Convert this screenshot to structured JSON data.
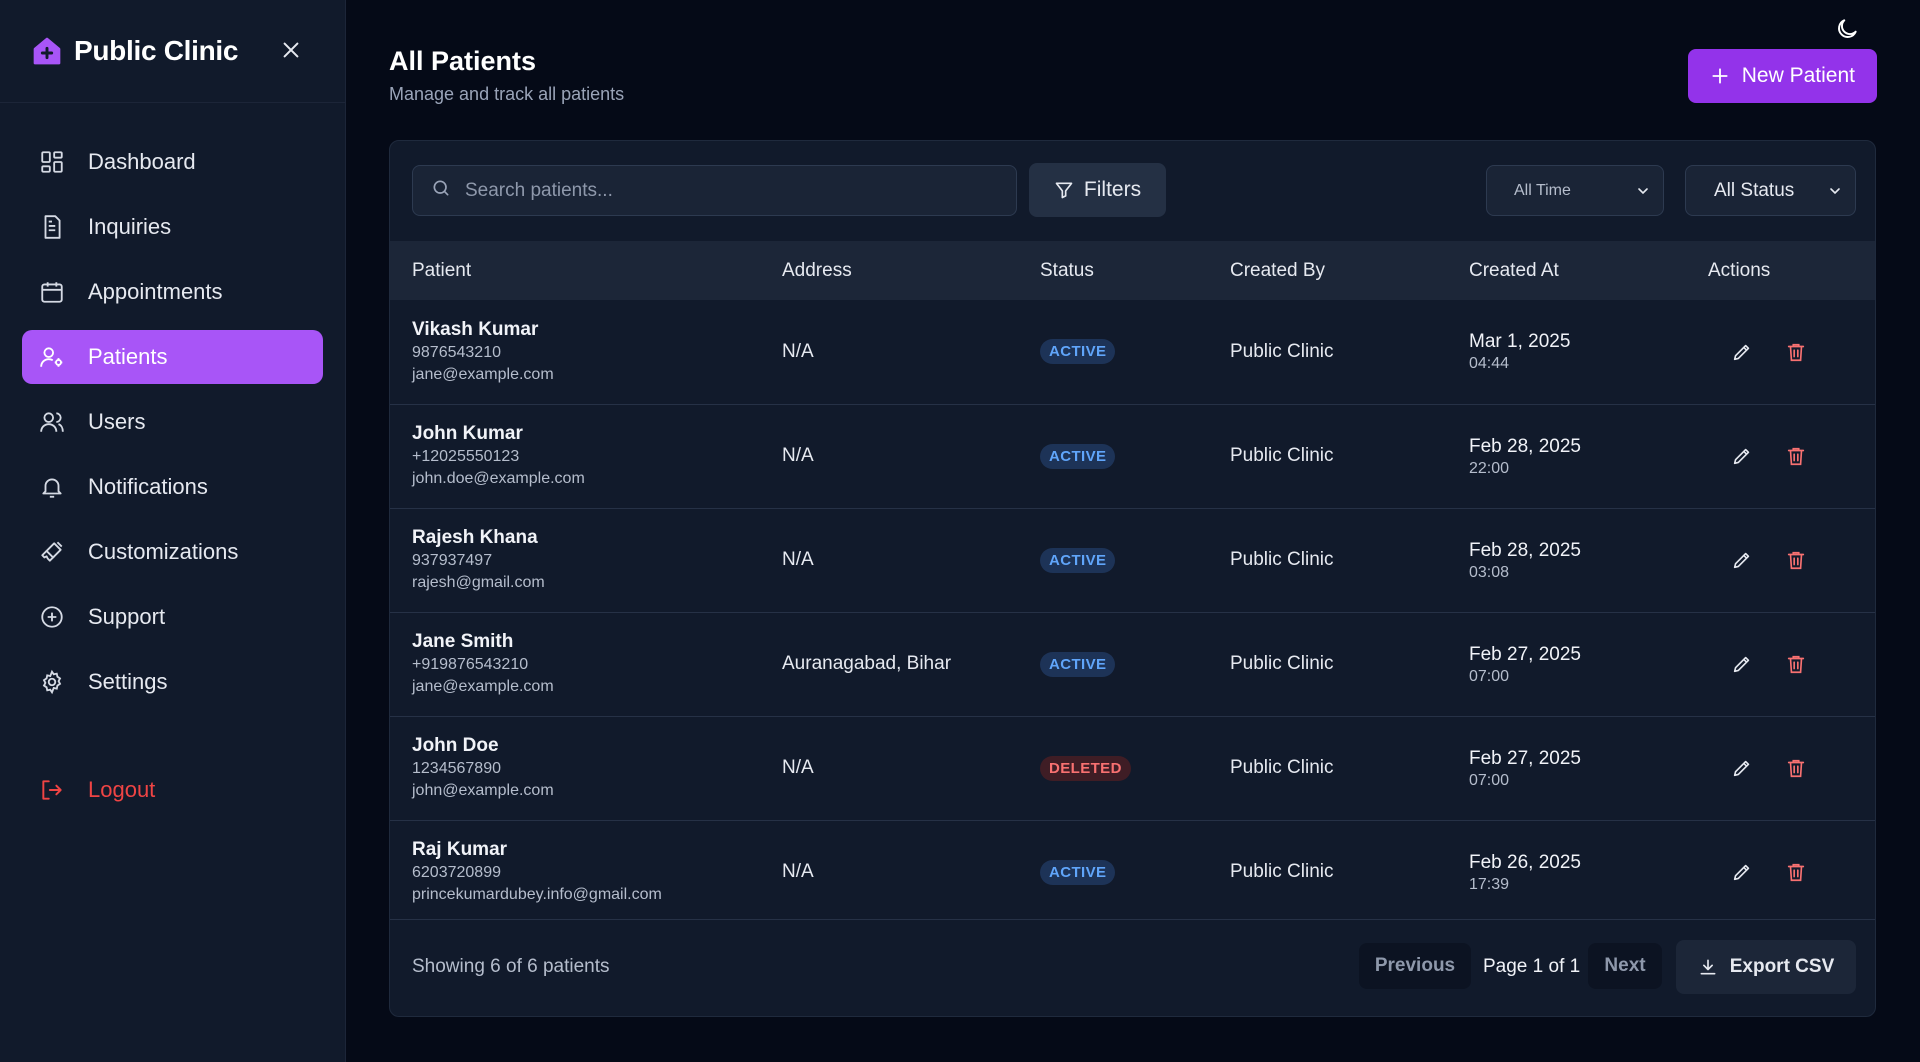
{
  "brand": {
    "name": "Public Clinic"
  },
  "nav": {
    "items": [
      {
        "label": "Dashboard",
        "icon": "dashboard-icon"
      },
      {
        "label": "Inquiries",
        "icon": "document-icon"
      },
      {
        "label": "Appointments",
        "icon": "calendar-icon"
      },
      {
        "label": "Patients",
        "icon": "user-cog-icon",
        "active": true
      },
      {
        "label": "Users",
        "icon": "users-icon"
      },
      {
        "label": "Notifications",
        "icon": "bell-icon"
      },
      {
        "label": "Customizations",
        "icon": "brush-icon"
      },
      {
        "label": "Support",
        "icon": "plus-circle-icon"
      },
      {
        "label": "Settings",
        "icon": "gear-icon"
      }
    ],
    "logout": "Logout"
  },
  "header": {
    "title": "All Patients",
    "subtitle": "Manage and track all patients",
    "new_button": "New Patient"
  },
  "toolbar": {
    "search_placeholder": "Search patients...",
    "filters_label": "Filters",
    "time_filter": "All Time",
    "status_filter": "All Status"
  },
  "table": {
    "columns": [
      "Patient",
      "Address",
      "Status",
      "Created By",
      "Created At",
      "Actions"
    ],
    "rows": [
      {
        "name": "Vikash Kumar",
        "phone": "9876543210",
        "email": "jane@example.com",
        "address": "N/A",
        "status": "ACTIVE",
        "created_by": "Public Clinic",
        "date": "Mar 1, 2025",
        "time": "04:44"
      },
      {
        "name": "John Kumar",
        "phone": "+12025550123",
        "email": "john.doe@example.com",
        "address": "N/A",
        "status": "ACTIVE",
        "created_by": "Public Clinic",
        "date": "Feb 28, 2025",
        "time": "22:00"
      },
      {
        "name": "Rajesh Khana",
        "phone": "937937497",
        "email": "rajesh@gmail.com",
        "address": "N/A",
        "status": "ACTIVE",
        "created_by": "Public Clinic",
        "date": "Feb 28, 2025",
        "time": "03:08"
      },
      {
        "name": "Jane Smith",
        "phone": "+919876543210",
        "email": "jane@example.com",
        "address": "Auranagabad, Bihar",
        "status": "ACTIVE",
        "created_by": "Public Clinic",
        "date": "Feb 27, 2025",
        "time": "07:00"
      },
      {
        "name": "John Doe",
        "phone": "1234567890",
        "email": "john@example.com",
        "address": "N/A",
        "status": "DELETED",
        "created_by": "Public Clinic",
        "date": "Feb 27, 2025",
        "time": "07:00"
      },
      {
        "name": "Raj Kumar",
        "phone": "6203720899",
        "email": "princekumardubey.info@gmail.com",
        "address": "N/A",
        "status": "ACTIVE",
        "created_by": "Public Clinic",
        "date": "Feb 26, 2025",
        "time": "17:39"
      }
    ]
  },
  "footer": {
    "showing": "Showing 6 of 6 patients",
    "previous": "Previous",
    "page_info": "Page 1 of 1",
    "next": "Next",
    "export": "Export CSV"
  },
  "colors": {
    "accent": "#a855f7",
    "accent_button": "#9333ea",
    "active_badge": "#60a5fa",
    "deleted_badge": "#f87171",
    "logout": "#ef4444"
  }
}
